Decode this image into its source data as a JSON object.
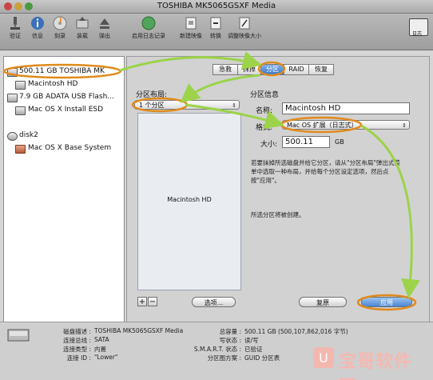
{
  "window": {
    "title": "TOSHIBA MK5065GSXF Media"
  },
  "toolbar": {
    "buttons": [
      {
        "label": "验证",
        "icon": "microscope-icon"
      },
      {
        "label": "信息",
        "icon": "info-icon"
      },
      {
        "label": "刻录",
        "icon": "burn-icon"
      },
      {
        "label": "装载",
        "icon": "mount-icon"
      },
      {
        "label": "弹出",
        "icon": "eject-icon"
      },
      {
        "label": "启用日志记录",
        "icon": "journal-icon"
      },
      {
        "label": "新建映像",
        "icon": "new-image-icon"
      },
      {
        "label": "转换",
        "icon": "convert-icon"
      },
      {
        "label": "调整映像大小",
        "icon": "resize-image-icon"
      }
    ],
    "log_label": "日志"
  },
  "sidebar": {
    "items": [
      {
        "label": "500.11 GB TOSHIBA MK",
        "icon": "hdd-icon"
      },
      {
        "label": "Macintosh HD",
        "icon": "volume-icon"
      },
      {
        "label": "7.9 GB ADATA USB Flash...",
        "icon": "usb-drive-icon"
      },
      {
        "label": "Mac OS X Install ESD",
        "icon": "volume-icon"
      },
      {
        "label": "disk2",
        "icon": "disk-image-icon"
      },
      {
        "label": "Mac OS X Base System",
        "icon": "volume-icon"
      }
    ]
  },
  "tabs": [
    "急救",
    "抹掉",
    "分区",
    "RAID",
    "恢复"
  ],
  "partition": {
    "layout_title": "分区布局:",
    "layout_value": "1 个分区",
    "partition_label": "Macintosh HD",
    "info_title": "分区信息",
    "name_label": "名称:",
    "name_value": "Macintosh HD",
    "format_label": "格式:",
    "format_value": "Mac OS 扩展（日志式）",
    "size_label": "大小:",
    "size_value": "500.11",
    "size_unit": "GB",
    "description": [
      "若要抹掉所选磁盘并给它分区，请从\"分区布局\"弹出式菜",
      "单中选取一种布局，并给每个分区设定选项，然后点",
      "按\"应用\"。"
    ],
    "status_text": "所选分区将被创建。",
    "add_btn": "+",
    "remove_btn": "−",
    "options_btn": "选项...",
    "revert_btn": "复原",
    "apply_btn": "应用"
  },
  "footer": {
    "left": [
      {
        "key": "磁盘描述 :",
        "value": "TOSHIBA MK5065GSXF Media"
      },
      {
        "key": "连接总线 :",
        "value": "SATA"
      },
      {
        "key": "连接类型 :",
        "value": "内置"
      },
      {
        "key": "连接 ID :",
        "value": "\"Lower\""
      }
    ],
    "right": [
      {
        "key": "总容量 :",
        "value": "500.11 GB (500,107,862,016 字节)"
      },
      {
        "key": "写状态 :",
        "value": "读/写"
      },
      {
        "key": "S.M.A.R.T. 状态 :",
        "value": "已验证"
      },
      {
        "key": "分区图方案 :",
        "value": "GUID 分区表"
      }
    ]
  },
  "watermark": {
    "text": "宝哥软件园"
  },
  "colors": {
    "highlight_ring": "#e08a1e",
    "arrow": "#9cd34a"
  }
}
